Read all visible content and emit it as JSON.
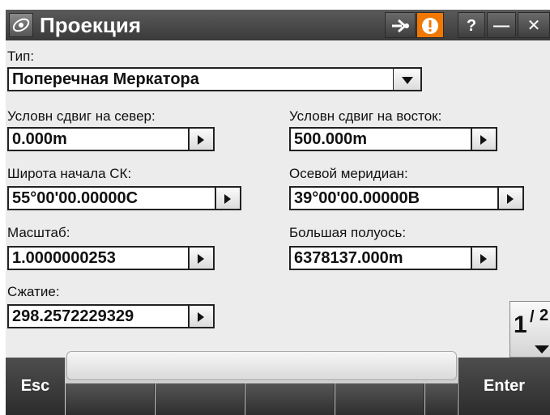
{
  "titlebar": {
    "title": "Проекция",
    "app_icon": "trimble-icon",
    "help_label": "?",
    "minimize_label": "—",
    "close_label": "✕"
  },
  "form": {
    "type_label": "Тип:",
    "type_value": "Поперечная Меркатора",
    "false_northing_label": "Условн сдвиг на север:",
    "false_northing_value": "0.000m",
    "false_easting_label": "Условн сдвиг на восток:",
    "false_easting_value": "500.000m",
    "origin_lat_label": "Широта начала СК:",
    "origin_lat_value": "55°00'00.00000С",
    "central_meridian_label": "Осевой меридиан:",
    "central_meridian_value": "39°00'00.00000В",
    "scale_label": "Масштаб:",
    "scale_value": "1.0000000253",
    "semi_major_label": "Большая полуось:",
    "semi_major_value": "6378137.000m",
    "flattening_label": "Сжатие:",
    "flattening_value": "298.2572229329"
  },
  "page": {
    "current": "1",
    "total": "2"
  },
  "softkeys": {
    "esc_label": "Esc",
    "enter_label": "Enter"
  },
  "colors": {
    "titlebar": "#4a4a4a",
    "warning_badge": "#f07800",
    "background": "#ececec"
  }
}
